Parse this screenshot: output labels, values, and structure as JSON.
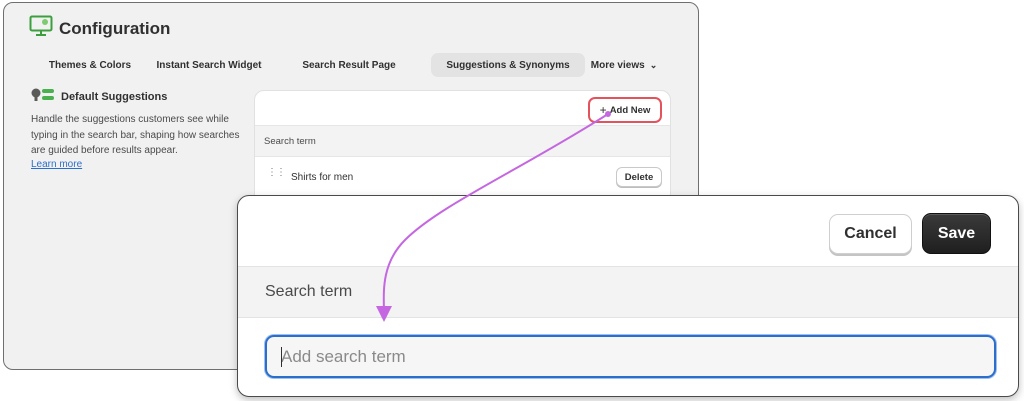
{
  "app": {
    "title": "Configuration",
    "icon": "monitor-settings-icon",
    "accent": "#5cb85c"
  },
  "tabs": [
    {
      "label": "Themes & Colors",
      "active": false
    },
    {
      "label": "Instant Search Widget",
      "active": false
    },
    {
      "label": "Search Result Page",
      "active": false
    },
    {
      "label": "Suggestions & Synonyms",
      "active": true
    },
    {
      "label": "More views",
      "active": false,
      "icon": "chevron-down-icon"
    }
  ],
  "section": {
    "title": "Default Suggestions",
    "icon": "suggestions-toggle-icon",
    "description": "Handle the suggestions customers see while typing in the search bar, shaping how searches are guided before results appear.",
    "link": "Learn more"
  },
  "card": {
    "add_label": "Add New",
    "add_icon": "plus-icon",
    "header": "Search term",
    "rows": [
      {
        "term": "Shirts for men",
        "delete_label": "Delete"
      }
    ]
  },
  "zoom": {
    "cancel_label": "Cancel",
    "save_label": "Save",
    "header": "Search term",
    "input_placeholder": "Add search term",
    "input_value": ""
  },
  "colors": {
    "highlight": "#e4525c",
    "arrow": "#c467e0",
    "focus": "#2c6ecb",
    "save_bg": "#262626"
  }
}
